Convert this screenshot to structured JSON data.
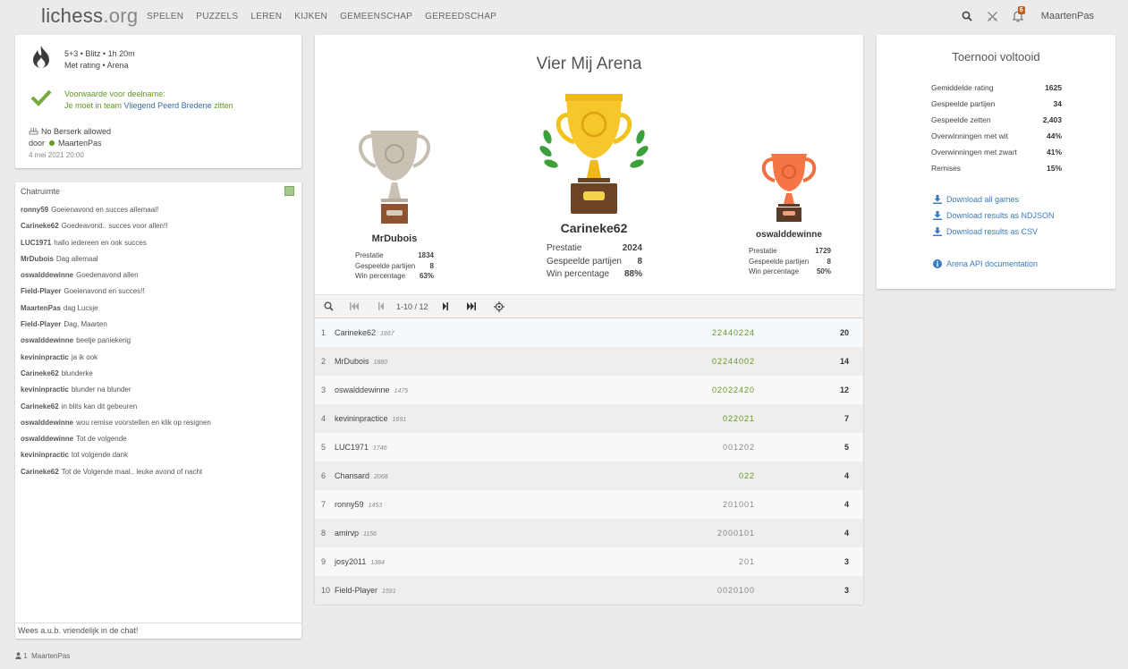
{
  "nav": {
    "logo_main": "lichess",
    "logo_tld": ".org",
    "items": [
      "SPELEN",
      "PUZZELS",
      "LEREN",
      "KIJKEN",
      "GEMEENSCHAP",
      "GEREEDSCHAP"
    ],
    "notification_count": "6",
    "username": "MaartenPas"
  },
  "info": {
    "clock_line": "5+3 • Blitz • 1h 20m",
    "rated_line": "Met rating • Arena",
    "condition_title": "Voorwaarde voor deelname:",
    "condition_prefix": "Je moet in team",
    "condition_team": "Vliegend Peerd Bredene",
    "condition_suffix": "zitten",
    "berserk": "No Berserk allowed",
    "by_label": "door",
    "creator": "MaartenPas",
    "date": "4 mei 2021 20:00"
  },
  "chat": {
    "title": "Chatruimte",
    "placeholder": "Wees a.u.b. vriendelijk in de chat!",
    "messages": [
      {
        "user": "ronny59",
        "text": "Goeienavond en succes allemaal!"
      },
      {
        "user": "Carineke62",
        "text": "Goedeavond.. succes voor allen!!"
      },
      {
        "user": "LUC1971",
        "text": "hallo iedereen en ook succes"
      },
      {
        "user": "MrDubois",
        "text": "Dag allemaal"
      },
      {
        "user": "oswalddewinne",
        "text": "Goedenavond allen"
      },
      {
        "user": "Field-Player",
        "text": "Goeienavond en succes!!"
      },
      {
        "user": "MaartenPas",
        "text": "dag Lucsje"
      },
      {
        "user": "Field-Player",
        "text": "Dag, Maarten"
      },
      {
        "user": "oswalddewinne",
        "text": "beetje paniekerig"
      },
      {
        "user": "kevininpractic",
        "text": "ja ik ook"
      },
      {
        "user": "Carineke62",
        "text": "blunderke"
      },
      {
        "user": "kevininpractic",
        "text": "blunder na blunder"
      },
      {
        "user": "Carineke62",
        "text": "in blits kan dit gebeuren"
      },
      {
        "user": "oswalddewinne",
        "text": "wou remise voorstellen en klik op resignen"
      },
      {
        "user": "oswalddewinne",
        "text": "Tot de volgende"
      },
      {
        "user": "kevininpractic",
        "text": "tot volgende dank"
      },
      {
        "user": "Carineke62",
        "text": "Tot de Volgende maal.. leuke avond of nacht"
      }
    ]
  },
  "spectators": {
    "count": "1",
    "name": "MaartenPas"
  },
  "tournament": {
    "name": "Vier Mij Arena",
    "stat_labels": {
      "perf": "Prestatie",
      "games": "Gespeelde partijen",
      "win": "Win percentage"
    },
    "podium": [
      {
        "place": 1,
        "name": "Carineke62",
        "perf": "2024",
        "games": "8",
        "win": "88%"
      },
      {
        "place": 2,
        "name": "MrDubois",
        "perf": "1834",
        "games": "8",
        "win": "63%"
      },
      {
        "place": 3,
        "name": "oswalddewinne",
        "perf": "1729",
        "games": "8",
        "win": "50%"
      }
    ],
    "pager": "1-10 / 12",
    "standings": [
      {
        "rank": "1",
        "name": "Carineke62",
        "rating": "1867",
        "sheet": "22440224",
        "total": "20",
        "fire": true
      },
      {
        "rank": "2",
        "name": "MrDubois",
        "rating": "1880",
        "sheet": "02244002",
        "total": "14",
        "fire": true
      },
      {
        "rank": "3",
        "name": "oswalddewinne",
        "rating": "1475",
        "sheet": "02022420",
        "total": "12",
        "fire": true
      },
      {
        "rank": "4",
        "name": "kevininpractice",
        "rating": "1691",
        "sheet": "022021",
        "total": "7",
        "fire": true
      },
      {
        "rank": "5",
        "name": "LUC1971",
        "rating": "1746",
        "sheet": "001202",
        "total": "5",
        "fire": false
      },
      {
        "rank": "6",
        "name": "Chansard",
        "rating": "2068",
        "sheet": "022",
        "total": "4",
        "fire": true
      },
      {
        "rank": "7",
        "name": "ronny59",
        "rating": "1453",
        "sheet": "201001",
        "total": "4",
        "fire": false
      },
      {
        "rank": "8",
        "name": "amirvp",
        "rating": "1156",
        "sheet": "2000101",
        "total": "4",
        "fire": false
      },
      {
        "rank": "9",
        "name": "josy2011",
        "rating": "1384",
        "sheet": "201",
        "total": "3",
        "fire": false
      },
      {
        "rank": "10",
        "name": "Field-Player",
        "rating": "1591",
        "sheet": "0020100",
        "total": "3",
        "fire": false
      }
    ]
  },
  "stats": {
    "title": "Toernooi voltooid",
    "rows": [
      {
        "label": "Gemiddelde rating",
        "value": "1625"
      },
      {
        "label": "Gespeelde partijen",
        "value": "34"
      },
      {
        "label": "Gespeelde zetten",
        "value": "2,403"
      },
      {
        "label": "Overwinningen met wit",
        "value": "44%"
      },
      {
        "label": "Overwinningen met zwart",
        "value": "41%"
      },
      {
        "label": "Remises",
        "value": "15%"
      }
    ],
    "links": {
      "all_games": "Download all games",
      "ndjson": "Download results as NDJSON",
      "csv": "Download results as CSV",
      "api": "Arena API documentation"
    }
  },
  "colors": {
    "fire_green": "#629924",
    "link_blue": "#3a7bbf",
    "neutral": "#888888"
  }
}
